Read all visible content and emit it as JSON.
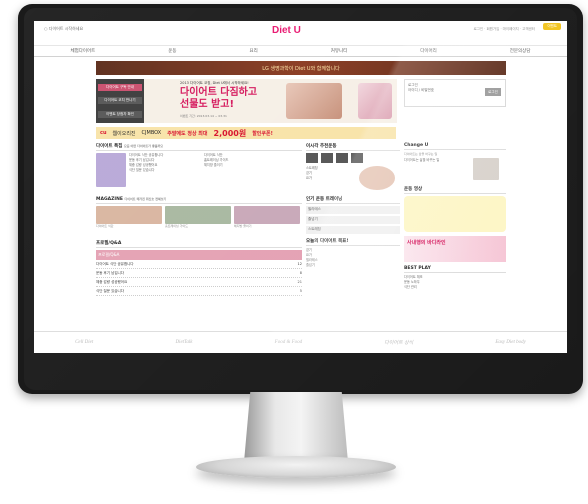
{
  "header": {
    "util_left": "○ 다이어트 시작하세요",
    "logo": "Diet U",
    "util_right": "로그인 · 회원가입 · 마이페이지 · 고객센터",
    "badge": "이벤트"
  },
  "gnb": [
    "체험다이어트",
    "운동",
    "요리",
    "커뮤니티",
    "다이어리",
    "전문의상담"
  ],
  "banner": "LG 생명과학이 Diet U와 함께합니다",
  "hero": {
    "side_items": [
      "다이어트 구독 안내",
      "다이어트 코치 만나기",
      "이벤트 당첨자 확인"
    ],
    "sub": "2013 다이어트 코칭, Diet U에서 시작하세요!",
    "title_line1": "다이어트 다짐하고",
    "title_line2": "선물도 받고!",
    "date": "이벤트 기간: 2013.03.14 ~ 03.31"
  },
  "login": {
    "line1": "로그인",
    "line2": "아이디 / 비밀번호",
    "button": "로그인"
  },
  "adbar": {
    "brand1": "cu",
    "brand2": "웹이오리진",
    "brand3": "CJMBOX",
    "text": "주말에도 정상 최대",
    "amount": "2,000원",
    "tail": "할인쿠폰!"
  },
  "col1": {
    "section1_title": "다이어트 특집",
    "section1_sub": "요즘 어떤 다이어트가 좋을까요",
    "magazine_title": "MAGAZINE",
    "magazine_sub": "다이어트 매거진 최신호 전체보기",
    "mag_items": [
      "다이어트 식단",
      "홈트레이닝 가이드",
      "체지방 줄이기"
    ],
    "board_title": "프로필/Q&A",
    "board_rows": [
      {
        "title": "다이어트 식단 공유합니다",
        "count": "12"
      },
      {
        "title": "운동 후기 남깁니다",
        "count": "8"
      },
      {
        "title": "체중 감량 성공했어요",
        "count": "21"
      },
      {
        "title": "식단 질문 있습니다",
        "count": "5"
      }
    ]
  },
  "col2": {
    "title1": "이시각 추천운동",
    "title2": "인기 운동 트레이닝",
    "title3": "오늘의 다이어트 목표!",
    "items": [
      "스트레칭",
      "걷기",
      "요가",
      "필라테스",
      "줄넘기"
    ]
  },
  "col3": {
    "title": "Change U",
    "sub": "다이어트는 삶을 바꾸는 일",
    "video_title": "운동 영상",
    "promo": "사내행의 바디라인",
    "best": "BEST PLAY",
    "best_items": [
      "다이어트 체조",
      "운동 노하우",
      "식단 관리"
    ]
  },
  "footer": {
    "items": [
      "Cell Diet",
      "DietTalk",
      "Food & Food",
      "다이어트 상식",
      "Easy Diet body"
    ],
    "info": "LG U+ | 고객센터 | 개인정보처리방침 | 이용약관 | Copyright LG U+ All rights reserved."
  }
}
